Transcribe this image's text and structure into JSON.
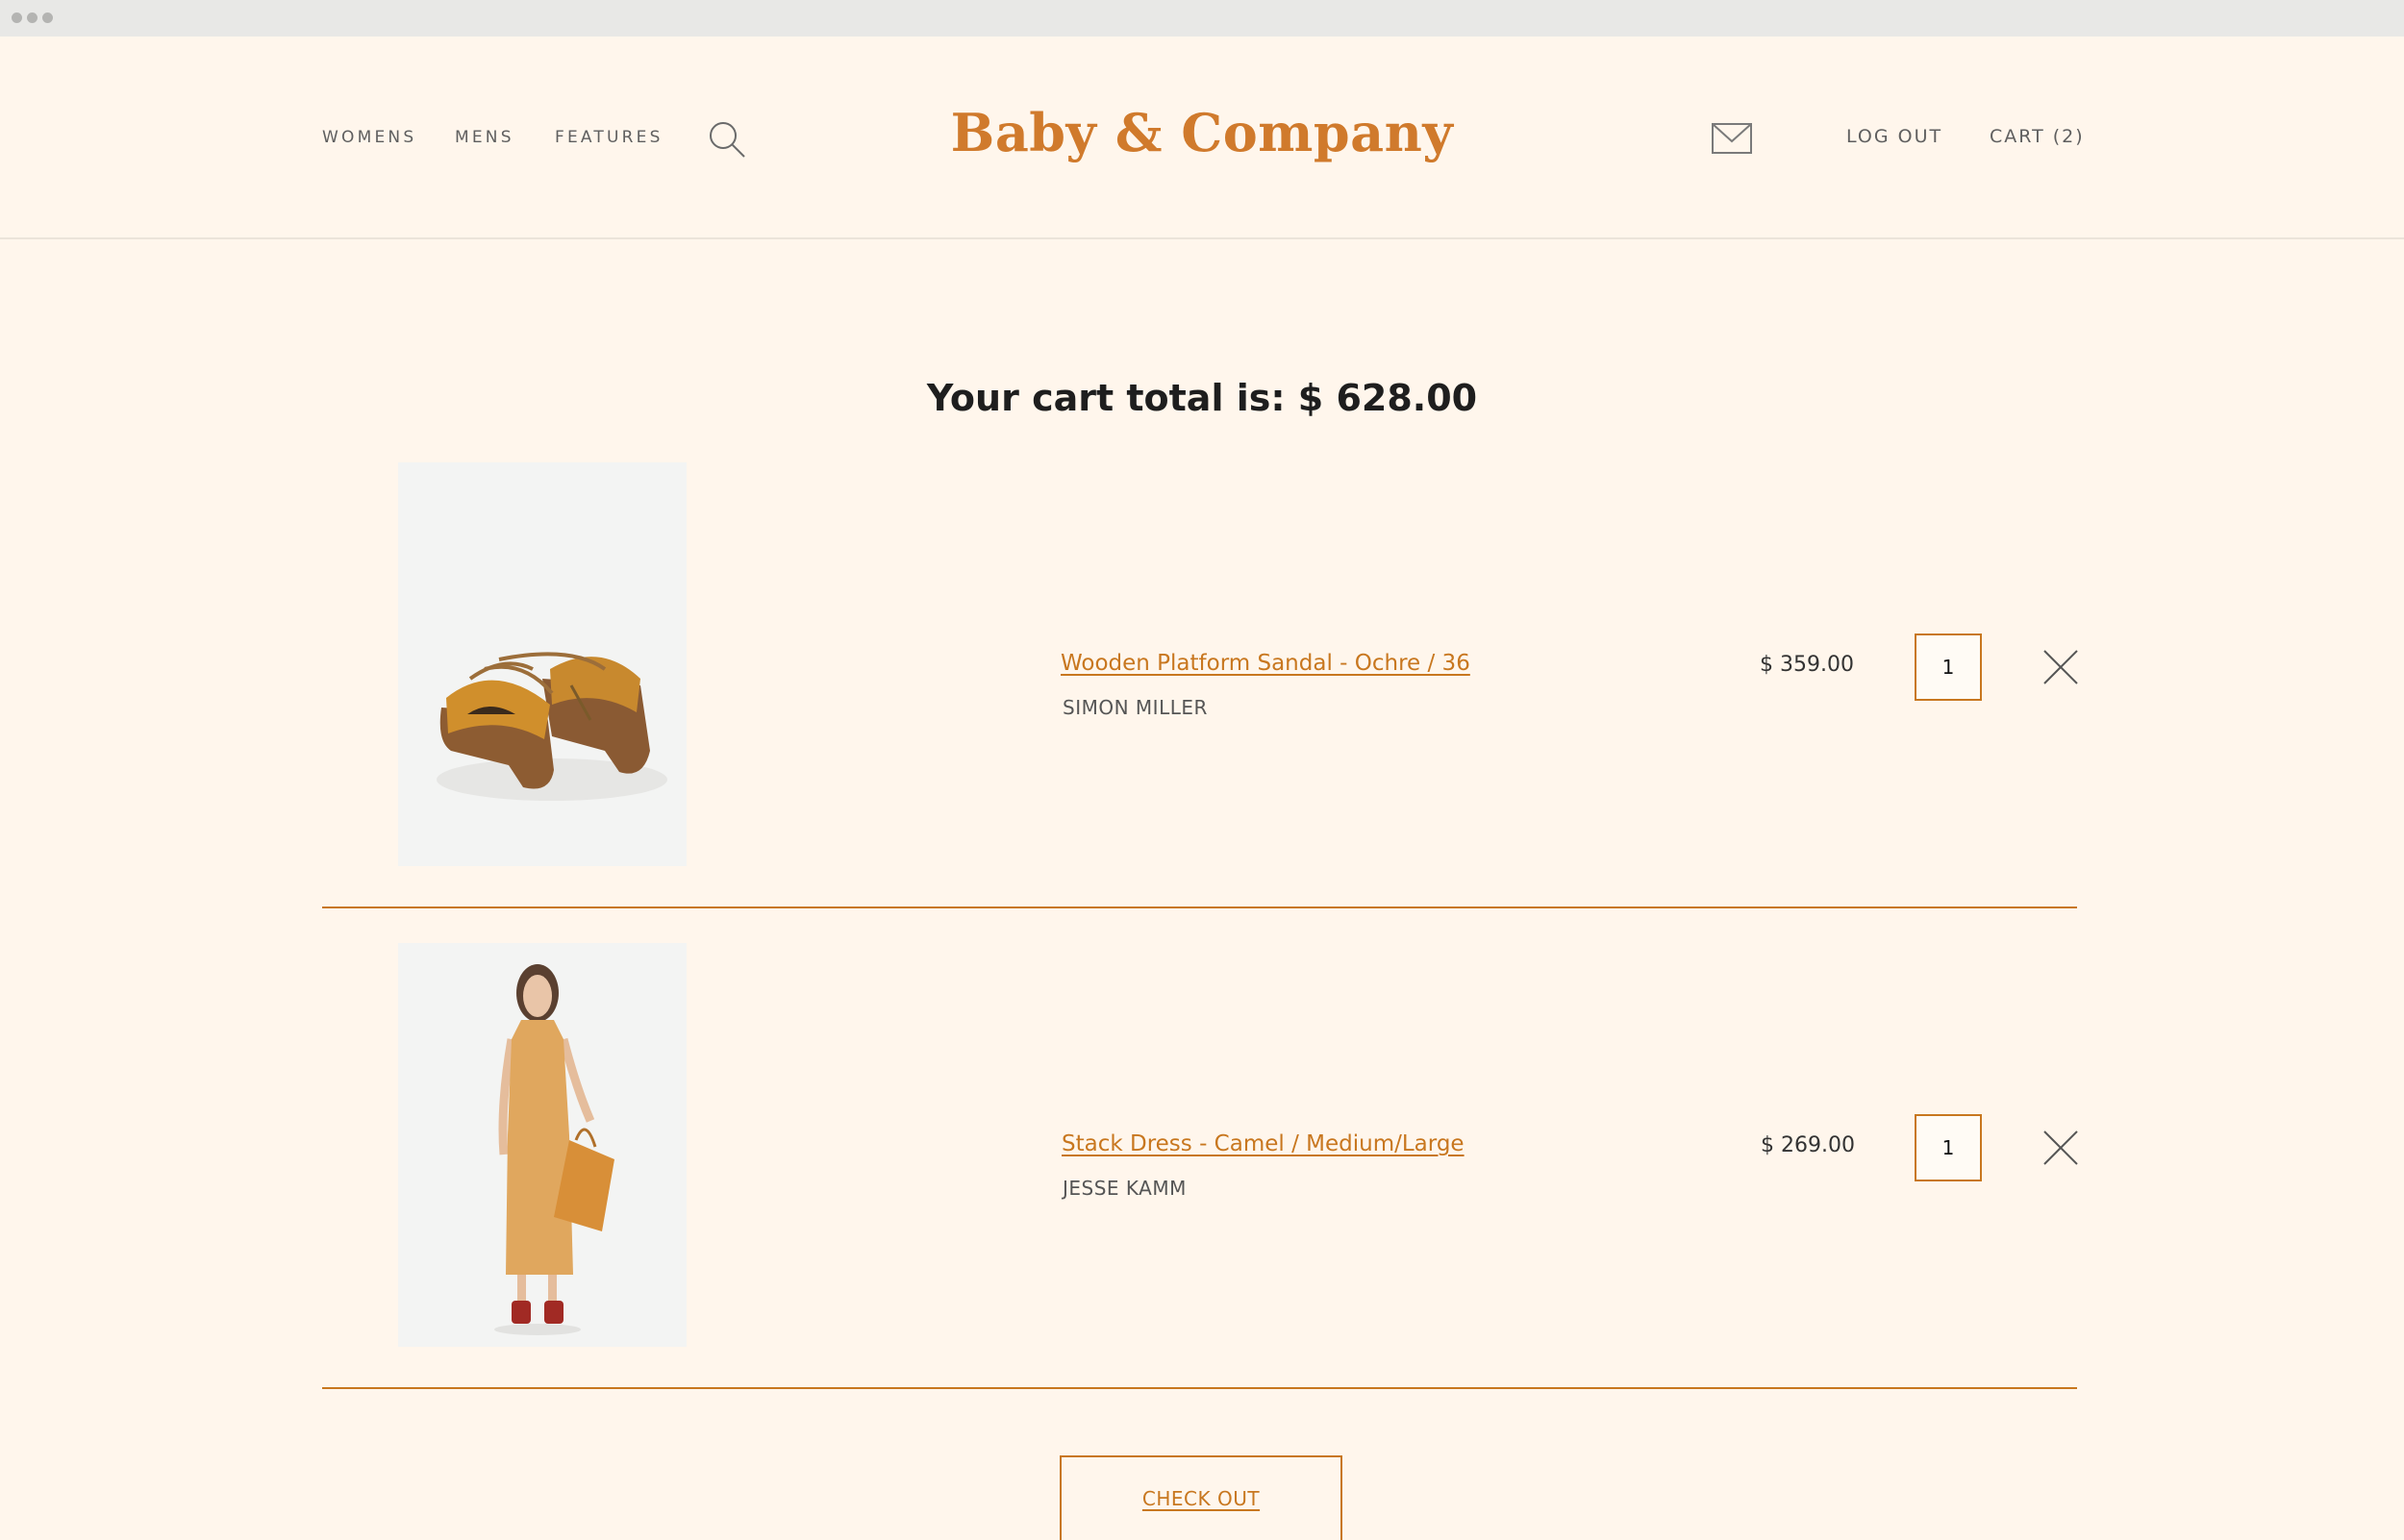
{
  "header": {
    "nav": [
      "WOMENS",
      "MENS",
      "FEATURES"
    ],
    "logo": "Baby & Company",
    "logout_label": "LOG OUT",
    "cart_label": "CART (2)"
  },
  "cart": {
    "title": "Your cart total is: $ 628.00",
    "items": [
      {
        "name": "Wooden Platform Sandal - Ochre / 36",
        "brand": "SIMON MILLER",
        "price": "$ 359.00",
        "qty": "1"
      },
      {
        "name": "Stack Dress - Camel / Medium/Large",
        "brand": "JESSE KAMM",
        "price": "$ 269.00",
        "qty": "1"
      }
    ],
    "checkout_label": "CHECK OUT"
  },
  "colors": {
    "accent": "#c8771f",
    "logo": "#d07a2c",
    "background": "#fff6ec"
  },
  "icons": [
    "search-icon",
    "mail-icon",
    "close-icon"
  ]
}
